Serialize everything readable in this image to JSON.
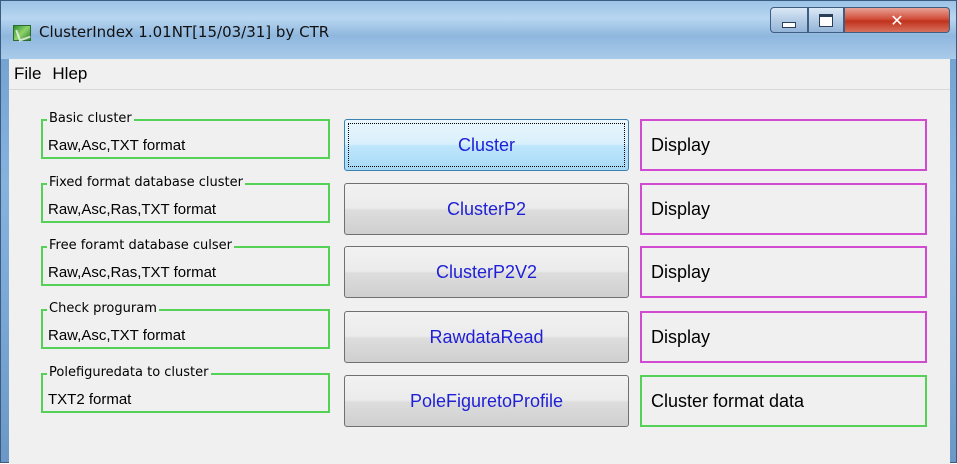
{
  "window": {
    "title": "ClusterIndex 1.01NT[15/03/31] by CTR"
  },
  "menu": [
    "File",
    "Hlep"
  ],
  "rows": [
    {
      "group_title": "Basic cluster",
      "group_text": "Raw,Asc,TXT format",
      "button": "Cluster",
      "output": "Display"
    },
    {
      "group_title": "Fixed format database  cluster",
      "group_text": "Raw,Asc,Ras,TXT format",
      "button": "ClusterP2",
      "output": "Display"
    },
    {
      "group_title": "Free foramt database culser",
      "group_text": "Raw,Asc,Ras,TXT format",
      "button": "ClusterP2V2",
      "output": "Display"
    },
    {
      "group_title": "Check proguram",
      "group_text": "Raw,Asc,TXT format",
      "button": "RawdataRead",
      "output": "Display"
    },
    {
      "group_title": "Polefiguredata to cluster",
      "group_text": "TXT2 format",
      "button": "PoleFiguretoProfile",
      "output": "Cluster format data"
    }
  ],
  "colors": {
    "group_border": "#55d155",
    "output_border_magenta": "#d24ad2",
    "output_border_green": "#55d155",
    "button_text": "#1f1fd6"
  },
  "icons": [
    "app-icon",
    "minimize-icon",
    "maximize-icon",
    "close-icon"
  ]
}
